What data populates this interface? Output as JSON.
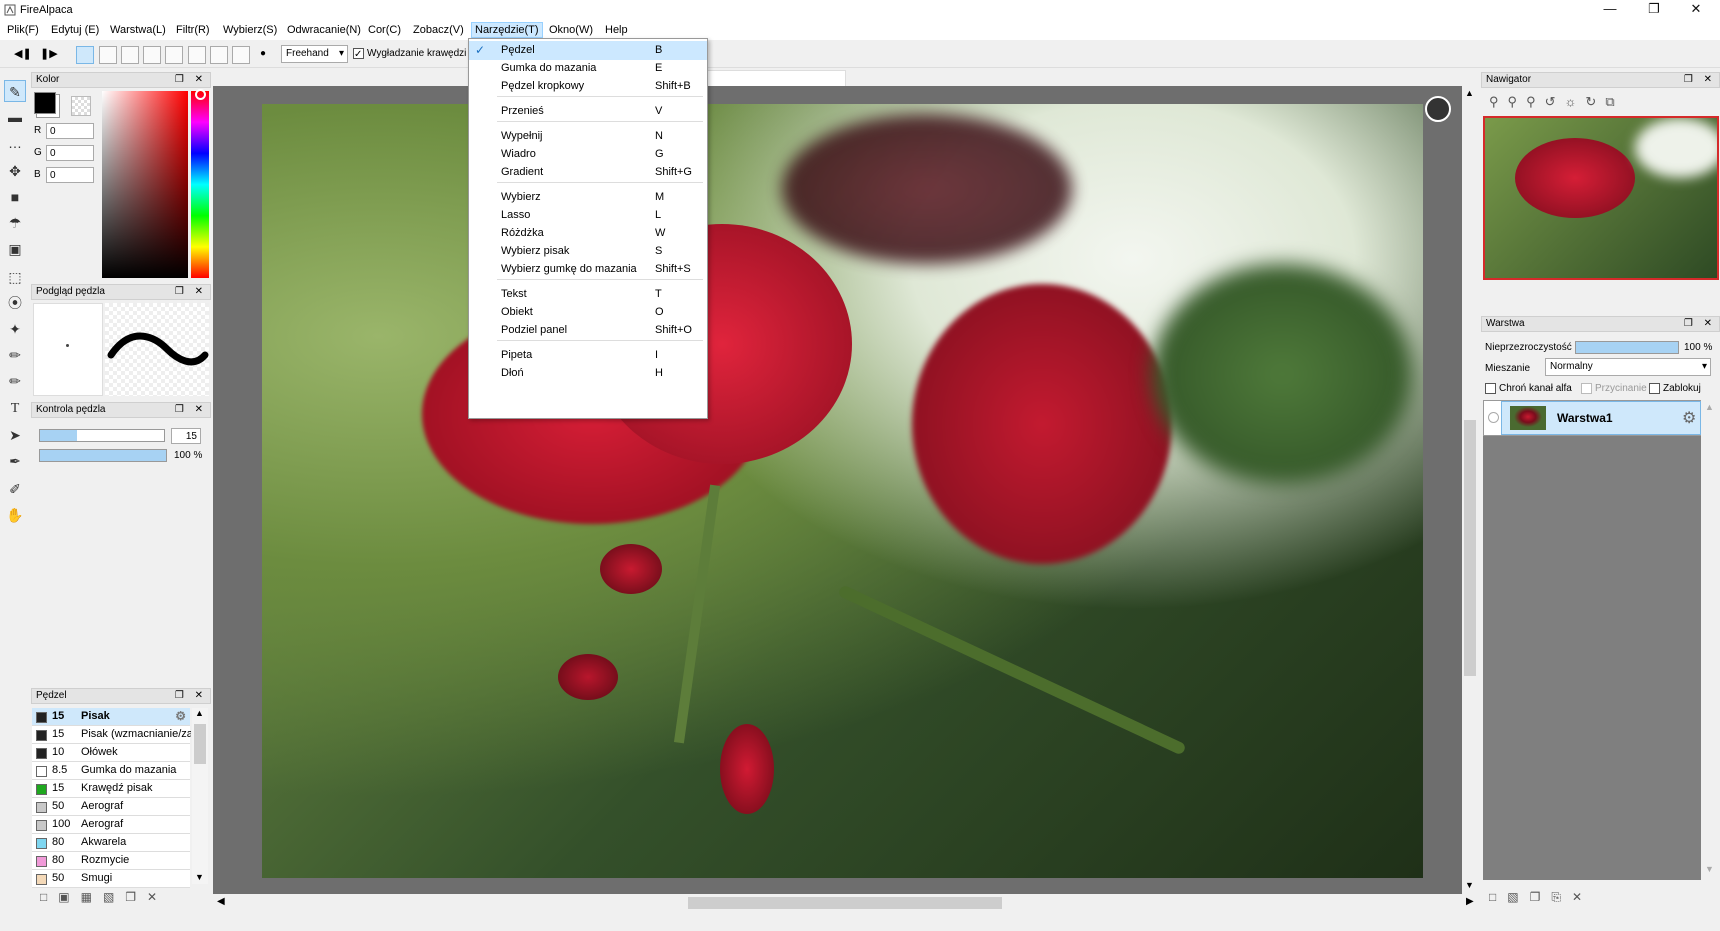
{
  "app": {
    "title": "FireAlpaca"
  },
  "menubar": [
    "Plik(F)",
    "Edytuj (E)",
    "Warstwa(L)",
    "Filtr(R)",
    "Wybierz(S)",
    "Odwracanie(N)",
    "Cor(C)",
    "Zobacz(V)",
    "Narzędzie(T)",
    "Okno(W)",
    "Help"
  ],
  "toolbar": {
    "mode_select": "Freehand",
    "antialias_label": "Wygładzanie krawędzi"
  },
  "dropdown": {
    "items": [
      {
        "label": "Pędzel",
        "shortcut": "B",
        "checked": true
      },
      {
        "label": "Gumka do mazania",
        "shortcut": "E"
      },
      {
        "label": "Pędzel kropkowy",
        "shortcut": "Shift+B"
      },
      {
        "label": "Przenieś",
        "shortcut": "V"
      },
      {
        "label": "Wypełnij",
        "shortcut": "N"
      },
      {
        "label": "Wiadro",
        "shortcut": "G"
      },
      {
        "label": "Gradient",
        "shortcut": "Shift+G"
      },
      {
        "label": "Wybierz",
        "shortcut": "M"
      },
      {
        "label": "Lasso",
        "shortcut": "L"
      },
      {
        "label": "Różdżka",
        "shortcut": "W"
      },
      {
        "label": "Wybierz pisak",
        "shortcut": "S"
      },
      {
        "label": "Wybierz gumkę do mazania",
        "shortcut": "Shift+S"
      },
      {
        "label": "Tekst",
        "shortcut": "T"
      },
      {
        "label": "Obiekt",
        "shortcut": "O"
      },
      {
        "label": "Podziel panel",
        "shortcut": "Shift+O"
      },
      {
        "label": "Pipeta",
        "shortcut": "I"
      },
      {
        "label": "Dłoń",
        "shortcut": "H"
      }
    ]
  },
  "color_panel": {
    "title": "Kolor",
    "r_label": "R",
    "g_label": "G",
    "b_label": "B",
    "r": "0",
    "g": "0",
    "b": "0",
    "fg_color": "#000000"
  },
  "brush_preview": {
    "title": "Podgląd pędzla"
  },
  "brush_control": {
    "title": "Kontrola pędzla",
    "size": "15",
    "size_fraction": 0.3,
    "opacity": "100 %",
    "opacity_fraction": 1.0
  },
  "brush_panel": {
    "title": "Pędzel",
    "items": [
      {
        "size": "15",
        "name": "Pisak",
        "color": "#222222",
        "selected": true
      },
      {
        "size": "15",
        "name": "Pisak (wzmacnianie/zanikanie)",
        "color": "#222222"
      },
      {
        "size": "10",
        "name": "Ołówek",
        "color": "#222222"
      },
      {
        "size": "8.5",
        "name": "Gumka do mazania",
        "color": "#ffffff"
      },
      {
        "size": "15",
        "name": "Krawędź pisak",
        "color": "#1fa81f"
      },
      {
        "size": "50",
        "name": "Aerograf",
        "color": "#c8c8c8"
      },
      {
        "size": "100",
        "name": "Aerograf",
        "color": "#c8c8c8"
      },
      {
        "size": "80",
        "name": "Akwarela",
        "color": "#7fd6f0"
      },
      {
        "size": "80",
        "name": "Rozmycie",
        "color": "#f09ad8"
      },
      {
        "size": "50",
        "name": "Smugi",
        "color": "#f4d9b8"
      }
    ]
  },
  "navigator": {
    "title": "Nawigator"
  },
  "layer_panel": {
    "title": "Warstwa",
    "opacity_label": "Nieprzezroczystość",
    "opacity": "100 %",
    "opacity_fraction": 1.0,
    "blend_label": "Mieszanie",
    "blend": "Normalny",
    "protect_alpha": "Chroń kanał alfa",
    "clipping": "Przycinanie",
    "lock": "Zablokuj",
    "layers": [
      {
        "name": "Warstwa1"
      }
    ]
  }
}
